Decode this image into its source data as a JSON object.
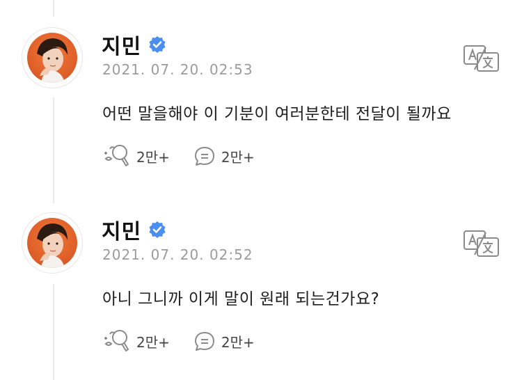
{
  "posts": [
    {
      "author": "지민",
      "timestamp": "2021. 07. 20. 02:53",
      "text": "어떤 말을해야 이 기분이 여러분한테 전달이 될까요",
      "likes": "2만+",
      "comments": "2만+"
    },
    {
      "author": "지민",
      "timestamp": "2021. 07. 20. 02:52",
      "text": "아니 그니까 이게 말이 원래 되는건가요?",
      "likes": "2만+",
      "comments": "2만+"
    }
  ],
  "colors": {
    "verified": "#4a8ff0",
    "avatar_bg": "#e2622a",
    "timestamp": "#9b9b9b",
    "icon_gray": "#8a8a8a"
  },
  "icons": {
    "verified": "verified-badge-icon",
    "translate": "translate-icon",
    "like": "lightstick-icon",
    "comment": "comment-bubble-icon"
  }
}
